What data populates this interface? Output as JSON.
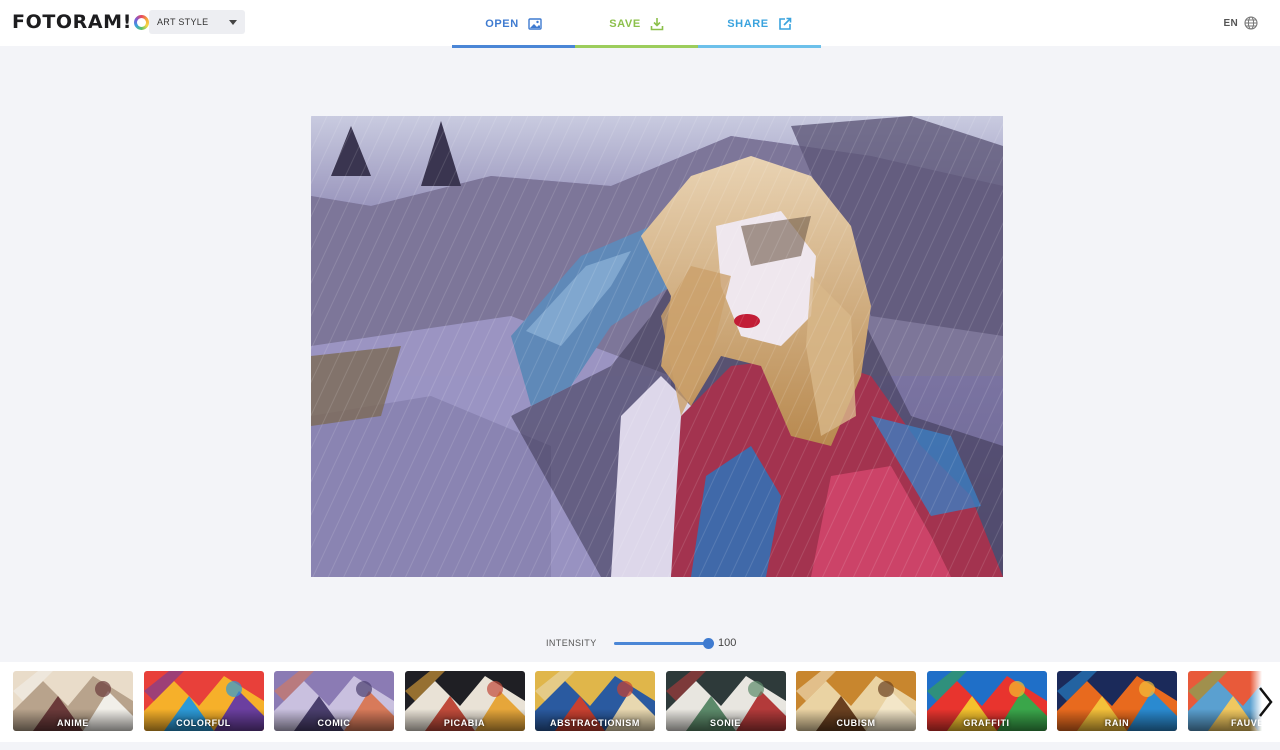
{
  "app": {
    "logo": "FOTORAM",
    "logo_suffix": "!O"
  },
  "style_select": {
    "value": "ART STYLE"
  },
  "nav": [
    {
      "label": "OPEN",
      "icon": "image-icon",
      "color": "#3f7bd0",
      "underline": "#4a86d6"
    },
    {
      "label": "SAVE",
      "icon": "download-icon",
      "color": "#8cc04b",
      "underline": "#9ccd5c"
    },
    {
      "label": "SHARE",
      "icon": "share-icon",
      "color": "#3aa3de",
      "underline": "#6cc0ea"
    }
  ],
  "language": {
    "code": "EN",
    "icon": "globe-icon"
  },
  "intensity": {
    "label": "INTENSITY",
    "value": "100",
    "fraction": 1.0
  },
  "filters": [
    {
      "label": "ANIME",
      "colors": [
        "#e9dcc9",
        "#b8a38c",
        "#6b3a3a",
        "#f1efe9"
      ]
    },
    {
      "label": "COLORFUL",
      "colors": [
        "#e8403a",
        "#f6b02a",
        "#2c9ad8",
        "#6b3fa0"
      ]
    },
    {
      "label": "COMIC",
      "colors": [
        "#8b7bb4",
        "#c9c0df",
        "#4a3f6e",
        "#d87a5a"
      ]
    },
    {
      "label": "PICABIA",
      "colors": [
        "#1f1f24",
        "#e9e2d6",
        "#c04a3a",
        "#e6a63a"
      ]
    },
    {
      "label": "ABSTRACTIONISM",
      "colors": [
        "#e0b64a",
        "#2a5aa0",
        "#c84030",
        "#e8d8b0"
      ]
    },
    {
      "label": "SONIE",
      "colors": [
        "#2e3a3a",
        "#e8e6e0",
        "#5c8a6a",
        "#b33a3a"
      ]
    },
    {
      "label": "CUBISM",
      "colors": [
        "#c8862e",
        "#ead3a3",
        "#6a4020",
        "#f3e6c8"
      ]
    },
    {
      "label": "GRAFFITI",
      "colors": [
        "#1f6fc8",
        "#e8342e",
        "#f4c12e",
        "#3aa64a"
      ]
    },
    {
      "label": "RAIN",
      "colors": [
        "#1b2a5a",
        "#e86a1e",
        "#f4c03a",
        "#2a8ad0"
      ]
    },
    {
      "label": "FAUVE",
      "colors": [
        "#e85a3a",
        "#5aa0d0",
        "#f0c860",
        "#6fb45a"
      ]
    }
  ],
  "colors": {
    "page_bg": "#f3f4f8",
    "header_bg": "#ffffff",
    "slider_accent": "#4a86d6"
  }
}
